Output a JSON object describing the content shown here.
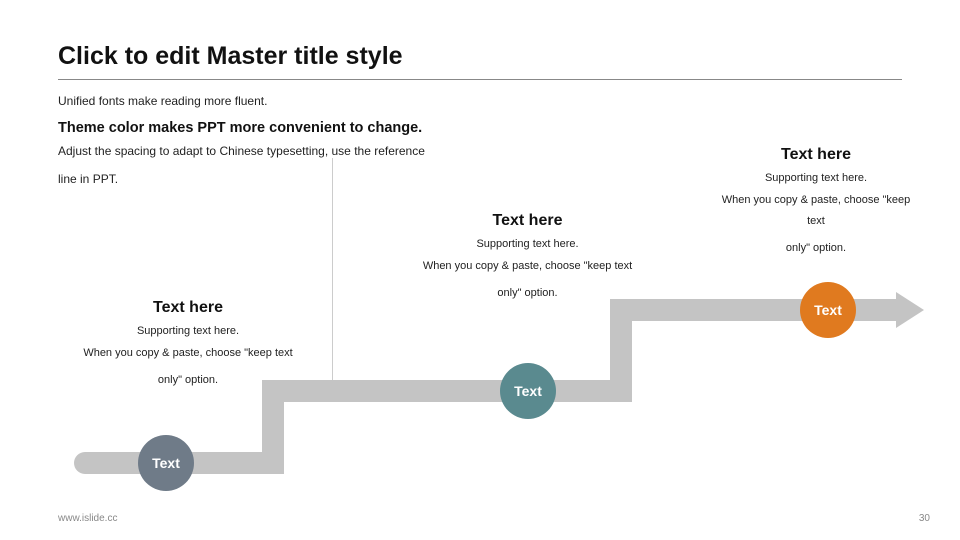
{
  "title": "Click to edit Master title style",
  "sub1": "Unified fonts make reading more fluent.",
  "sub2": "Theme color makes PPT more convenient to change.",
  "sub3a": "Adjust the spacing to adapt to Chinese typesetting, use the reference",
  "sub3b": "line in PPT.",
  "blocks": {
    "right": {
      "heading": "Text here",
      "support": "Supporting text here.",
      "desc1": "When you copy & paste, choose \"keep text",
      "desc2": "only\" option."
    },
    "mid": {
      "heading": "Text here",
      "support": "Supporting text here.",
      "desc1": "When you copy & paste, choose \"keep text",
      "desc2": "only\" option."
    },
    "left": {
      "heading": "Text here",
      "support": "Supporting text here.",
      "desc1": "When you copy & paste, choose \"keep text",
      "desc2": "only\" option."
    }
  },
  "dots": {
    "d1": "Text",
    "d2": "Text",
    "d3": "Text"
  },
  "footer": {
    "url": "www.islide.cc",
    "page": "30"
  }
}
